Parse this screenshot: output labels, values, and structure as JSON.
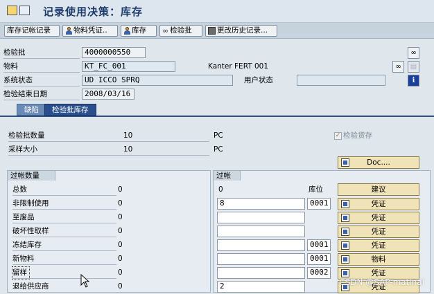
{
  "title": "记录使用决策：库存",
  "toolbar": {
    "stock_posting": "库存记帐记录",
    "material_doc": "物料凭证..",
    "stock": "库存",
    "inspection_lot": "检验批",
    "change_history": "更改历史记录..."
  },
  "header": {
    "inspection_lot_label": "检验批",
    "inspection_lot_value": "4000000550",
    "material_label": "物料",
    "material_value": "KT_FC_001",
    "material_desc": "Kanter FERT 001",
    "system_status_label": "系统状态",
    "system_status_value": "UD   ICCO SPRQ",
    "user_status_label": "用户状态",
    "user_status_value": "",
    "insp_end_date_label": "检验结束日期",
    "insp_end_date_value": "2008/03/16"
  },
  "tabs": [
    {
      "label": "缺陷"
    },
    {
      "label": "检验批库存"
    }
  ],
  "lot_quantity": {
    "label": "检验批数量",
    "value": "10",
    "unit": "PC",
    "checkbox_label": "检验货存"
  },
  "sample_size": {
    "label": "采样大小",
    "value": "10",
    "unit": "PC"
  },
  "doc_button": "Doc....",
  "left_group": {
    "title": "过帐数量",
    "rows": [
      {
        "label": "总数",
        "value": "0"
      },
      {
        "label": "非限制使用",
        "value": "0"
      },
      {
        "label": "至废品",
        "value": "0"
      },
      {
        "label": "破坏性取样",
        "value": "0"
      },
      {
        "label": "冻结库存",
        "value": "0"
      },
      {
        "label": "新物料",
        "value": "0"
      },
      {
        "label": "留样",
        "value": "0"
      },
      {
        "label": "退给供应商",
        "value": "0"
      }
    ]
  },
  "right_group": {
    "title": "过帐",
    "total": "0",
    "storage_loc_header": "库位",
    "proposal_button": "建议",
    "rows": [
      {
        "qty": "8",
        "sloc": "0001",
        "button": "凭证"
      },
      {
        "qty": "",
        "sloc": "",
        "button": "凭证"
      },
      {
        "qty": "",
        "sloc": "",
        "button": "凭证"
      },
      {
        "qty": "",
        "sloc": "0001",
        "button": "凭证"
      },
      {
        "qty": "",
        "sloc": "0001",
        "button": "物料"
      },
      {
        "qty": "",
        "sloc": "0002",
        "button": "凭证"
      },
      {
        "qty": "2",
        "sloc": "",
        "button": "凭证"
      }
    ]
  },
  "watermark": "CSDN @SAP-matinal",
  "colors": {
    "tab_active": "#2a4f8c",
    "button_bg": "#f0e3b8",
    "title": "#1d3a6a"
  }
}
